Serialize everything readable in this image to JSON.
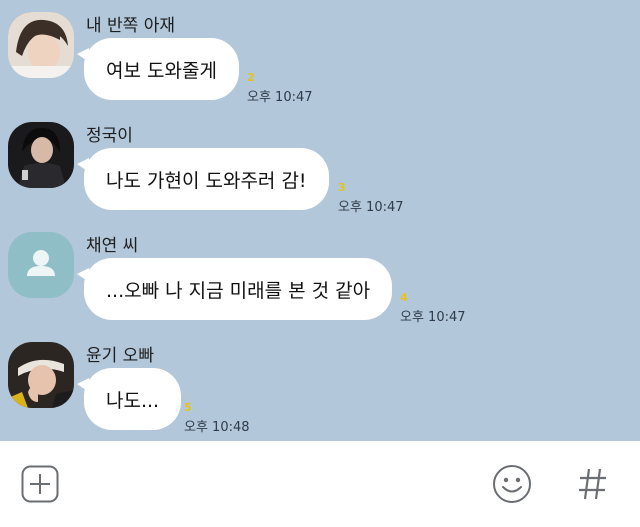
{
  "messages": [
    {
      "sender": "내 반쪽 아재",
      "text": "여보 도와줄게",
      "unread": "2",
      "time": "오후 10:47"
    },
    {
      "sender": "정국이",
      "text": "나도 가현이 도와주러 감!",
      "unread": "3",
      "time": "오후 10:47"
    },
    {
      "sender": "채연 씨",
      "text": "...오빠 나 지금 미래를 본 것 같아",
      "unread": "4",
      "time": "오후 10:47"
    },
    {
      "sender": "윤기 오빠",
      "text": "나도...",
      "unread": "5",
      "time": "오후 10:48"
    }
  ],
  "input_bar": {
    "left_icon": "plus-icon",
    "right_icons": [
      "emoji-icon",
      "hash-icon"
    ]
  },
  "colors": {
    "chat_bg": "#b2c7da",
    "bubble": "#ffffff",
    "unread": "#e6c21a",
    "default_avatar": "#8fbec6"
  }
}
